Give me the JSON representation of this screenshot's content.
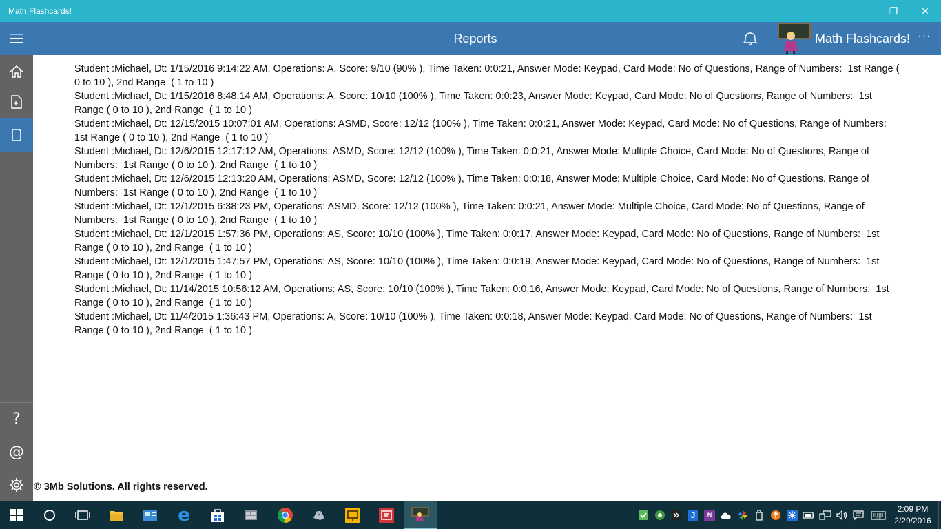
{
  "window": {
    "title": "Math Flashcards!",
    "minimize_glyph": "—",
    "restore_glyph": "❐",
    "close_glyph": "✕"
  },
  "header": {
    "page_title": "Reports",
    "app_name": "Math Flashcards!",
    "more_glyph": "···",
    "bg_color": "#3b78b2"
  },
  "sidebar": {
    "items": [
      {
        "name": "home",
        "icon": "home-icon"
      },
      {
        "name": "new-document",
        "icon": "document-add-icon"
      },
      {
        "name": "reports",
        "icon": "page-icon",
        "active": true
      },
      {
        "name": "help",
        "icon": "question-icon",
        "label": "?"
      },
      {
        "name": "contact",
        "icon": "at-icon",
        "label": "@"
      },
      {
        "name": "settings",
        "icon": "gear-icon"
      }
    ]
  },
  "reports": [
    "Student :Michael, Dt: 1/15/2016 9:14:22 AM, Operations: A, Score: 9/10 (90% ), Time Taken: 0:0:21, Answer Mode: Keypad, Card Mode: No of Questions, Range of Numbers:  1st Range ( 0 to 10 ), 2nd Range  ( 1 to 10 )",
    "Student :Michael, Dt: 1/15/2016 8:48:14 AM, Operations: A, Score: 10/10 (100% ), Time Taken: 0:0:23, Answer Mode: Keypad, Card Mode: No of Questions, Range of Numbers:  1st Range ( 0 to 10 ), 2nd Range  ( 1 to 10 )",
    "Student :Michael, Dt: 12/15/2015 10:07:01 AM, Operations: ASMD, Score: 12/12 (100% ), Time Taken: 0:0:21, Answer Mode: Keypad, Card Mode: No of Questions, Range of Numbers:  1st Range ( 0 to 10 ), 2nd Range  ( 1 to 10 )",
    "Student :Michael, Dt: 12/6/2015 12:17:12 AM, Operations: ASMD, Score: 12/12 (100% ), Time Taken: 0:0:21, Answer Mode: Multiple Choice, Card Mode: No of Questions, Range of Numbers:  1st Range ( 0 to 10 ), 2nd Range  ( 1 to 10 )",
    "Student :Michael, Dt: 12/6/2015 12:13:20 AM, Operations: ASMD, Score: 12/12 (100% ), Time Taken: 0:0:18, Answer Mode: Multiple Choice, Card Mode: No of Questions, Range of Numbers:  1st Range ( 0 to 10 ), 2nd Range  ( 1 to 10 )",
    "Student :Michael, Dt: 12/1/2015 6:38:23 PM, Operations: ASMD, Score: 12/12 (100% ), Time Taken: 0:0:21, Answer Mode: Multiple Choice, Card Mode: No of Questions, Range of Numbers:  1st Range ( 0 to 10 ), 2nd Range  ( 1 to 10 )",
    "Student :Michael, Dt: 12/1/2015 1:57:36 PM, Operations: AS, Score: 10/10 (100% ), Time Taken: 0:0:17, Answer Mode: Keypad, Card Mode: No of Questions, Range of Numbers:  1st Range ( 0 to 10 ), 2nd Range  ( 1 to 10 )",
    "Student :Michael, Dt: 12/1/2015 1:47:57 PM, Operations: AS, Score: 10/10 (100% ), Time Taken: 0:0:19, Answer Mode: Keypad, Card Mode: No of Questions, Range of Numbers:  1st Range ( 0 to 10 ), 2nd Range  ( 1 to 10 )",
    "Student :Michael, Dt: 11/14/2015 10:56:12 AM, Operations: AS, Score: 10/10 (100% ), Time Taken: 0:0:16, Answer Mode: Keypad, Card Mode: No of Questions, Range of Numbers:  1st Range ( 0 to 10 ), 2nd Range  ( 1 to 10 )",
    "Student :Michael, Dt: 11/4/2015 1:36:43 PM, Operations: A, Score: 10/10 (100% ), Time Taken: 0:0:18, Answer Mode: Keypad, Card Mode: No of Questions, Range of Numbers:  1st Range ( 0 to 10 ), 2nd Range  ( 1 to 10 )"
  ],
  "footer": "© 3Mb Solutions. All rights reserved.",
  "taskbar": {
    "apps": [
      "start-icon",
      "cortana-icon",
      "task-view-icon",
      "file-explorer-icon",
      "control-panel-icon",
      "edge-icon",
      "store-icon",
      "app-icon",
      "chrome-icon",
      "app-icon",
      "slides-icon",
      "app-icon",
      "math-flashcards-icon"
    ],
    "tray": [
      "check-icon",
      "gamepad-icon",
      "terminal-icon",
      "j-icon",
      "onenote-icon",
      "cloud-icon",
      "pinwheel-icon",
      "usb-icon",
      "upload-icon",
      "snowflake-icon",
      "battery-icon",
      "network-icon",
      "volume-icon",
      "message-icon",
      "keyboard-icon"
    ],
    "time": "2:09 PM",
    "date": "2/29/2016"
  },
  "colors": {
    "titlebar": "#2bb5cc",
    "sidebar": "#636363",
    "taskbar": "#0f2f3a"
  }
}
